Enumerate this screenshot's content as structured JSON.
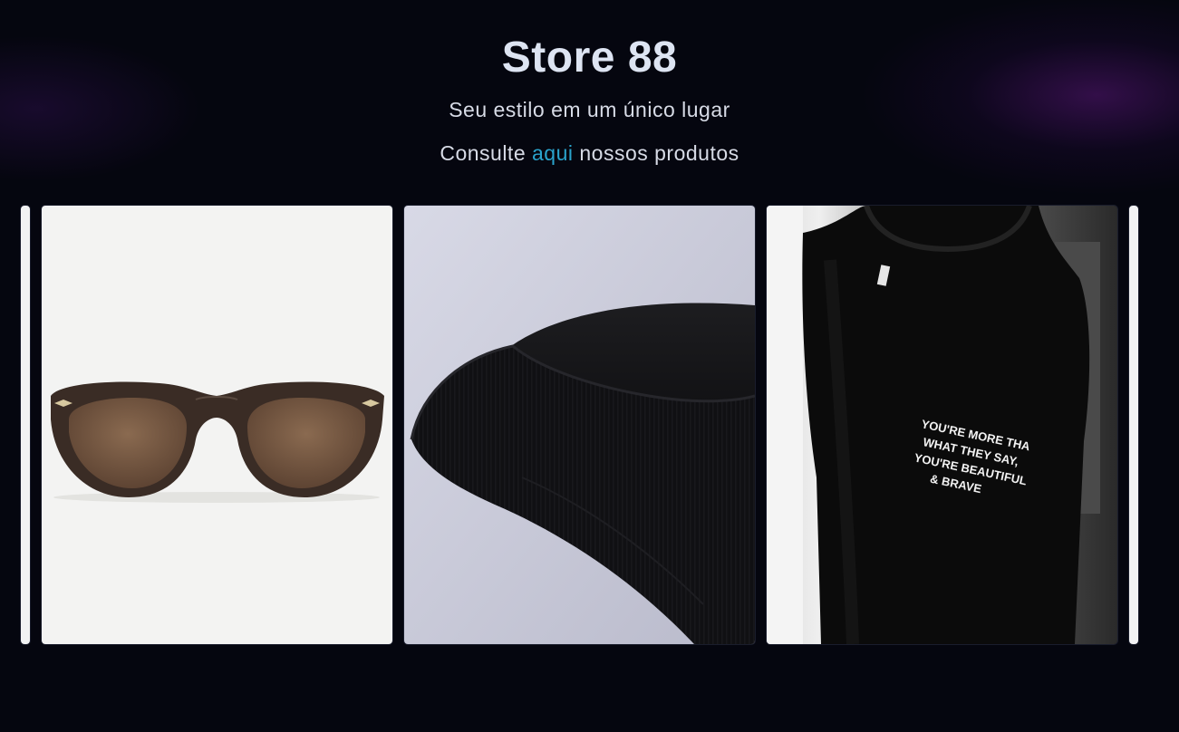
{
  "header": {
    "title": "Store 88",
    "subtitle": "Seu estilo em um único lugar",
    "consult_prefix": "Consulte",
    "consult_link": "aqui",
    "consult_suffix": "nossos produtos"
  },
  "carousel": {
    "items": [
      {
        "image": "sunglasses-image"
      },
      {
        "image": "beanie-image"
      },
      {
        "image": "tshirt-image",
        "print_lines": [
          "YOU'RE MORE THA",
          "WHAT THEY SAY,",
          "YOU'RE BEAUTIFUL",
          "& BRAVE"
        ]
      }
    ]
  },
  "colors": {
    "background": "#05060f",
    "title": "#dde4f2",
    "link": "#2aa3cc",
    "glow": "#581678"
  }
}
